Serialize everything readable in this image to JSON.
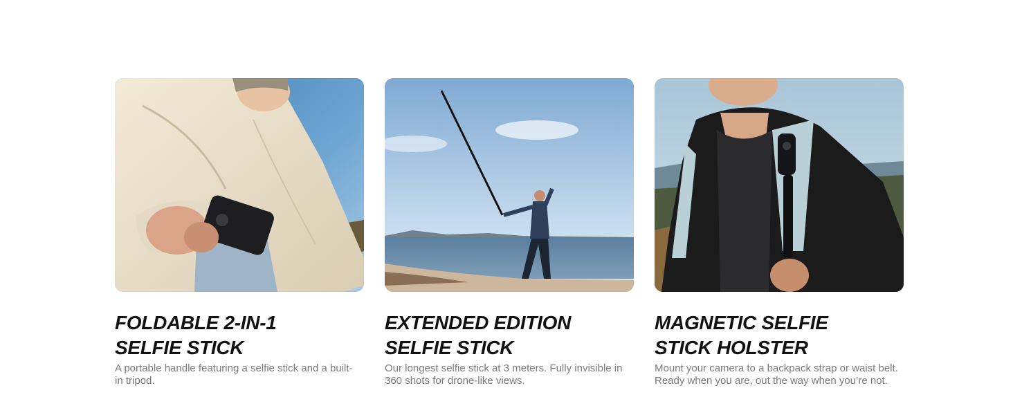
{
  "cards": [
    {
      "title_line1": "FOLDABLE 2-IN-1",
      "title_line2": "SELFIE STICK",
      "description": "A portable handle featuring a selfie stick and a built-in tripod.",
      "image_subject": "person-holding-folded-camera-handle"
    },
    {
      "title_line1": "EXTENDED EDITION",
      "title_line2": "SELFIE STICK",
      "description": "Our longest selfie stick at 3 meters. Fully invisible in 360 shots for drone-like views.",
      "image_subject": "person-on-beach-with-extended-selfie-stick"
    },
    {
      "title_line1": "MAGNETIC SELFIE",
      "title_line2": "STICK HOLSTER",
      "description": "Mount your camera to a backpack strap or waist belt. Ready when you are, out the way when you’re not.",
      "image_subject": "person-with-camera-on-backpack-strap"
    }
  ],
  "colors": {
    "title": "#111111",
    "description": "#7a7a7a",
    "background": "#ffffff"
  }
}
